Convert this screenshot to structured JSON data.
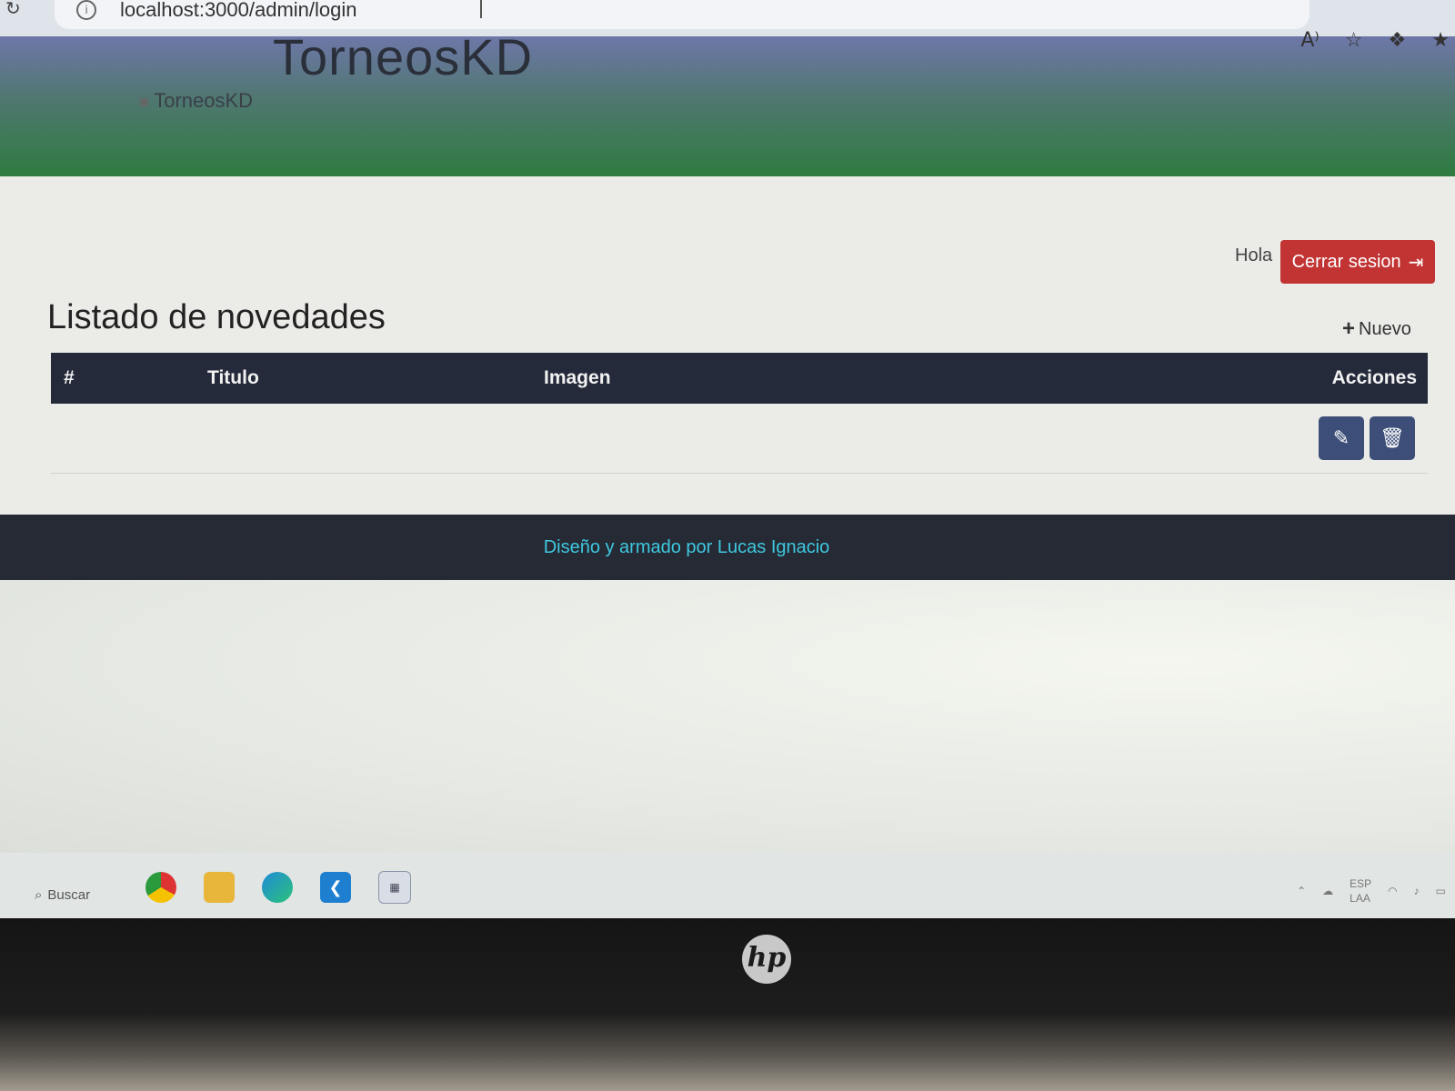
{
  "browser": {
    "url": "localhost:3000/admin/login",
    "reload_icon": "reload-icon",
    "info_icon": "info-icon",
    "toolbar_icons": [
      "read-aloud-icon",
      "add-favorite-icon",
      "extensions-icon",
      "favorites-icon"
    ]
  },
  "header": {
    "brand_title": "TorneosKD",
    "logo_alt": "TorneosKD"
  },
  "content": {
    "greeting": "Hola",
    "logout_label": "Cerrar sesion",
    "page_title": "Listado de novedades",
    "new_label": "Nuevo",
    "table": {
      "columns": [
        "#",
        "Titulo",
        "Imagen",
        "Acciones"
      ],
      "rows": [
        {
          "num": "",
          "titulo": "",
          "imagen": ""
        }
      ]
    }
  },
  "footer": {
    "text": "Diseño y armado por Lucas Ignacio"
  },
  "taskbar": {
    "search_label": "Buscar",
    "apps": [
      "chrome-icon",
      "file-explorer-icon",
      "edge-icon",
      "vscode-icon",
      "calendar-icon"
    ],
    "lang_primary": "ESP",
    "lang_secondary": "LAA"
  },
  "colors": {
    "header_green": "#2f7b40",
    "logout_red": "#c23434",
    "table_head": "#252a3a",
    "action_button": "#3d4f78",
    "footer_text": "#3fc8df"
  }
}
